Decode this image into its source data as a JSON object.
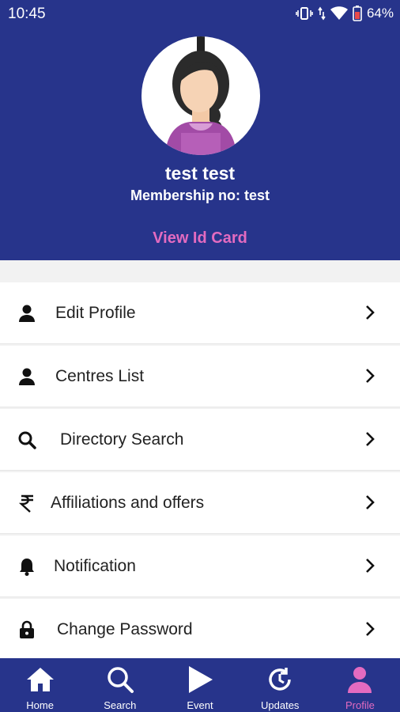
{
  "status_bar": {
    "time": "10:45",
    "battery": "64%"
  },
  "profile": {
    "name": "test  test",
    "membership": "Membership no: test",
    "view_id_card": "View Id Card"
  },
  "menu": [
    {
      "label": "Edit Profile",
      "icon": "user-icon"
    },
    {
      "label": "Centres List",
      "icon": "user-icon"
    },
    {
      "label": "Directory Search",
      "icon": "search-icon"
    },
    {
      "label": "Affiliations and offers",
      "icon": "rupee-icon"
    },
    {
      "label": "Notification",
      "icon": "bell-icon"
    },
    {
      "label": "Change Password",
      "icon": "lock-icon"
    }
  ],
  "nav": [
    {
      "label": "Home",
      "icon": "home-icon"
    },
    {
      "label": "Search",
      "icon": "search-icon"
    },
    {
      "label": "Event",
      "icon": "play-icon"
    },
    {
      "label": "Updates",
      "icon": "updates-icon"
    },
    {
      "label": "Profile",
      "icon": "profile-icon",
      "active": true
    }
  ],
  "colors": {
    "primary": "#27348b",
    "accent": "#e36bc0",
    "background": "#f2f2f2"
  }
}
